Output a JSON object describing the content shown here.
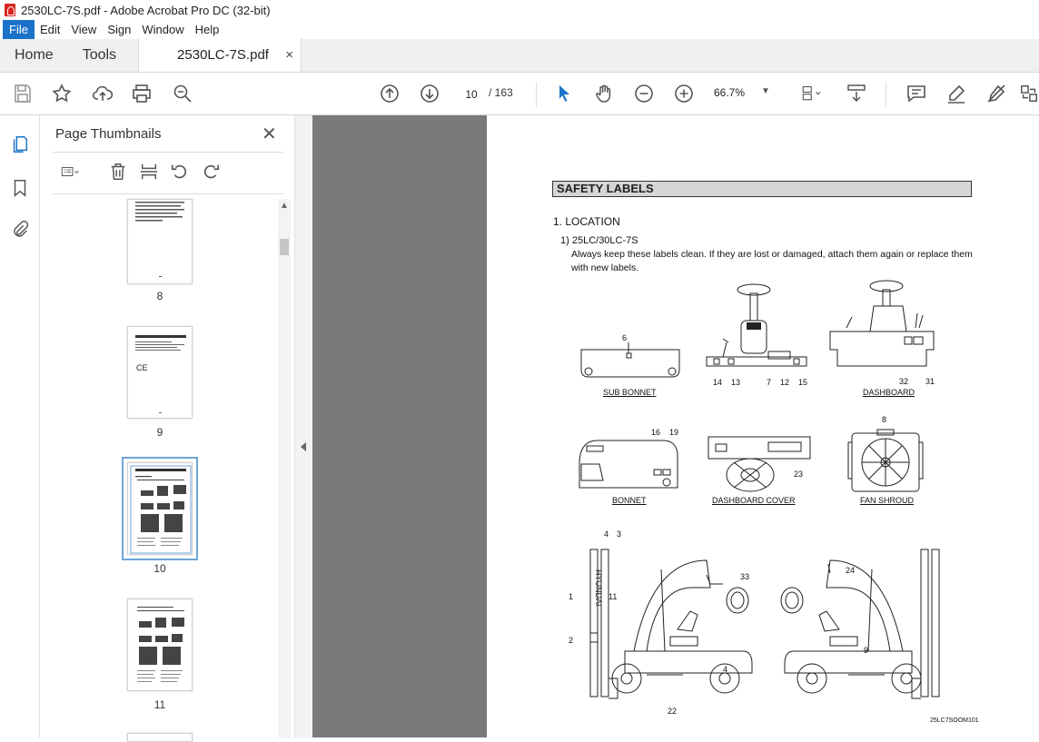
{
  "window": {
    "title": "2530LC-7S.pdf - Adobe Acrobat Pro DC (32-bit)"
  },
  "menu": [
    "File",
    "Edit",
    "View",
    "Sign",
    "Window",
    "Help"
  ],
  "tabs": {
    "home": "Home",
    "tools": "Tools",
    "document": "2530LC-7S.pdf",
    "close": "×"
  },
  "toolbar": {
    "current_page": "10",
    "total_pages": "/ 163",
    "zoom": "66.7%"
  },
  "panel": {
    "title": "Page Thumbnails",
    "close": "✕",
    "thumbnails": [
      {
        "label": "8",
        "selected": false
      },
      {
        "label": "9",
        "selected": false
      },
      {
        "label": "10",
        "selected": true
      },
      {
        "label": "11",
        "selected": false
      }
    ]
  },
  "page": {
    "section_title": "SAFETY LABELS",
    "heading": "1. LOCATION",
    "subheading": "1)  25LC/30LC-7S",
    "body_line1": "Always keep these labels clean.  If they are lost or damaged, attach them again or replace them",
    "body_line2": "with  new labels.",
    "diagram_labels": {
      "sub_bonnet": "SUB BONNET",
      "dashboard": "DASHBOARD",
      "bonnet": "BONNET",
      "dashboard_cover": "DASHBOARD COVER",
      "fan_shroud": "FAN SHROUD"
    },
    "numbers": {
      "n6": "6",
      "n14": "14",
      "n13": "13",
      "n7": "7",
      "n12": "12",
      "n15": "15",
      "n32": "32",
      "n31": "31",
      "n16": "16",
      "n19": "19",
      "n23": "23",
      "n8": "8",
      "n4a": "4",
      "n3": "3",
      "n33": "33",
      "n1": "1",
      "n11": "11",
      "n2": "2",
      "n4b": "4",
      "n22": "22",
      "n24": "24",
      "n9": "9"
    },
    "drawing_code": "25LC7SOOM101"
  }
}
